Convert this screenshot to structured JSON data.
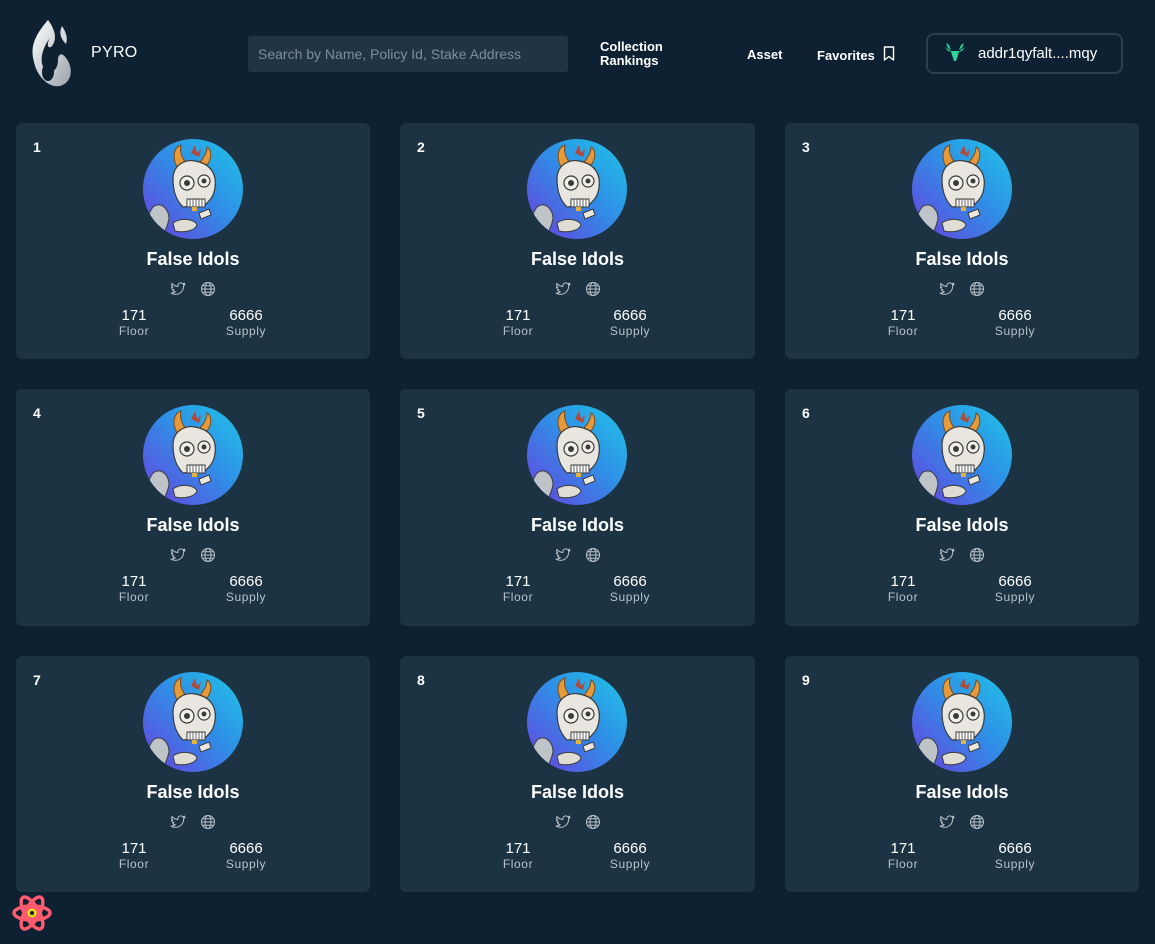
{
  "header": {
    "brand": "PYRO",
    "search_placeholder": "Search by Name, Policy Id, Stake Address",
    "nav": {
      "collection_rankings": "Collection Rankings",
      "asset": "Asset",
      "favorites": "Favorites"
    },
    "wallet": {
      "address": "addr1qyfalt....mqy",
      "icon": "stag-icon",
      "icon_color": "#2bd69a"
    }
  },
  "colors": {
    "background": "#0d2133",
    "card": "#1c3343",
    "input": "#1f3546"
  },
  "collections": [
    {
      "rank": "1",
      "name": "False Idols",
      "floor": "171",
      "floor_label": "Floor",
      "supply": "6666",
      "supply_label": "Supply"
    },
    {
      "rank": "2",
      "name": "False Idols",
      "floor": "171",
      "floor_label": "Floor",
      "supply": "6666",
      "supply_label": "Supply"
    },
    {
      "rank": "3",
      "name": "False Idols",
      "floor": "171",
      "floor_label": "Floor",
      "supply": "6666",
      "supply_label": "Supply"
    },
    {
      "rank": "4",
      "name": "False Idols",
      "floor": "171",
      "floor_label": "Floor",
      "supply": "6666",
      "supply_label": "Supply"
    },
    {
      "rank": "5",
      "name": "False Idols",
      "floor": "171",
      "floor_label": "Floor",
      "supply": "6666",
      "supply_label": "Supply"
    },
    {
      "rank": "6",
      "name": "False Idols",
      "floor": "171",
      "floor_label": "Floor",
      "supply": "6666",
      "supply_label": "Supply"
    },
    {
      "rank": "7",
      "name": "False Idols",
      "floor": "171",
      "floor_label": "Floor",
      "supply": "6666",
      "supply_label": "Supply"
    },
    {
      "rank": "8",
      "name": "False Idols",
      "floor": "171",
      "floor_label": "Floor",
      "supply": "6666",
      "supply_label": "Supply"
    },
    {
      "rank": "9",
      "name": "False Idols",
      "floor": "171",
      "floor_label": "Floor",
      "supply": "6666",
      "supply_label": "Supply"
    }
  ]
}
